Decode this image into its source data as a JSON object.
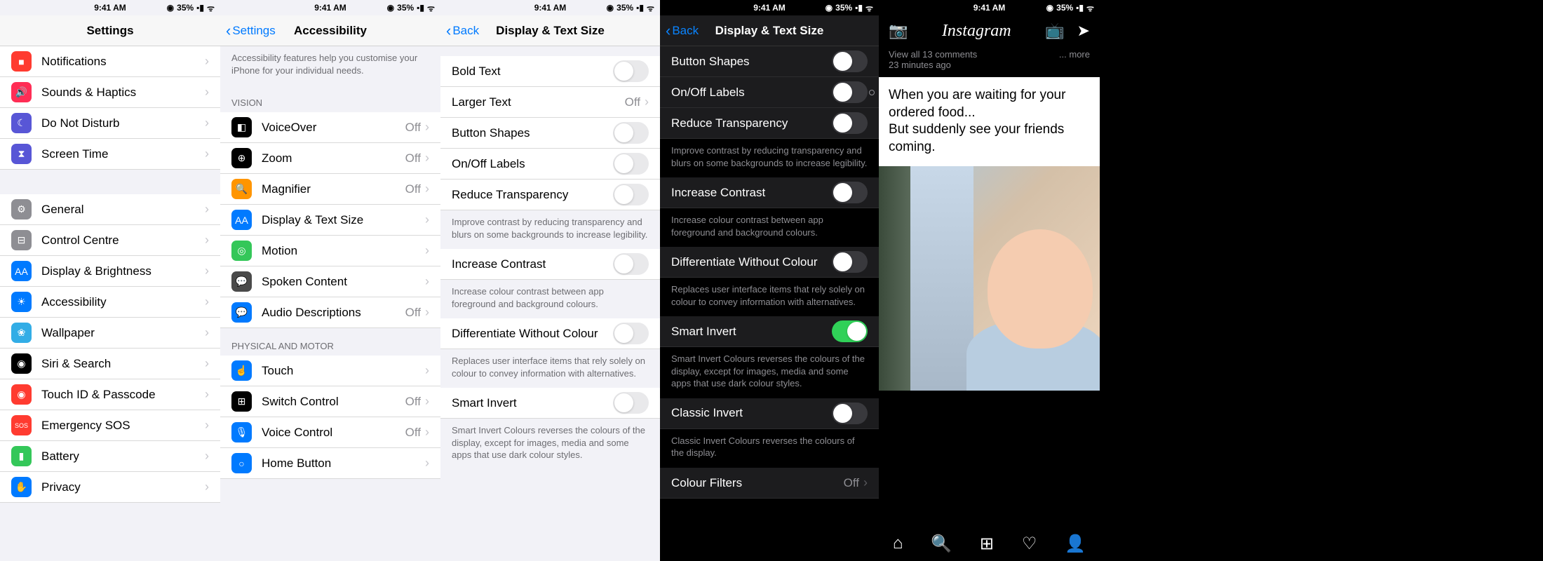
{
  "status": {
    "time": "9:41 AM",
    "battery": "35%",
    "wifi": "●"
  },
  "p1": {
    "title": "Settings",
    "group1": [
      {
        "icon_bg": "ic-red",
        "glyph": "■",
        "label": "Notifications"
      },
      {
        "icon_bg": "ic-pink",
        "glyph": "🔊",
        "label": "Sounds & Haptics"
      },
      {
        "icon_bg": "ic-purple",
        "glyph": "☾",
        "label": "Do Not Disturb"
      },
      {
        "icon_bg": "ic-indigo",
        "glyph": "⧗",
        "label": "Screen Time"
      }
    ],
    "group2": [
      {
        "icon_bg": "ic-gray",
        "glyph": "⚙",
        "label": "General"
      },
      {
        "icon_bg": "ic-gray",
        "glyph": "⊟",
        "label": "Control Centre"
      },
      {
        "icon_bg": "ic-blue",
        "glyph": "AA",
        "label": "Display & Brightness"
      },
      {
        "icon_bg": "ic-blue",
        "glyph": "☀",
        "label": "Accessibility"
      },
      {
        "icon_bg": "ic-cyan",
        "glyph": "❀",
        "label": "Wallpaper"
      },
      {
        "icon_bg": "ic-black",
        "glyph": "◉",
        "label": "Siri & Search"
      },
      {
        "icon_bg": "ic-red",
        "glyph": "◉",
        "label": "Touch ID & Passcode"
      },
      {
        "icon_bg": "ic-red",
        "glyph": "SOS",
        "label": "Emergency SOS"
      },
      {
        "icon_bg": "ic-green",
        "glyph": "▮",
        "label": "Battery"
      },
      {
        "icon_bg": "ic-blue",
        "glyph": "✋",
        "label": "Privacy"
      }
    ]
  },
  "p2": {
    "back": "Settings",
    "title": "Accessibility",
    "intro": "Accessibility features help you customise your iPhone for your individual needs.",
    "hdr_vision": "VISION",
    "vision": [
      {
        "icon_bg": "ic-black",
        "glyph": "◧",
        "label": "VoiceOver",
        "value": "Off"
      },
      {
        "icon_bg": "ic-black",
        "glyph": "⊕",
        "label": "Zoom",
        "value": "Off"
      },
      {
        "icon_bg": "ic-orange",
        "glyph": "🔍",
        "label": "Magnifier",
        "value": "Off"
      },
      {
        "icon_bg": "ic-blue",
        "glyph": "AA",
        "label": "Display & Text Size",
        "value": ""
      },
      {
        "icon_bg": "ic-green",
        "glyph": "◎",
        "label": "Motion",
        "value": ""
      },
      {
        "icon_bg": "ic-darkgray",
        "glyph": "💬",
        "label": "Spoken Content",
        "value": ""
      },
      {
        "icon_bg": "ic-blue",
        "glyph": "💬",
        "label": "Audio Descriptions",
        "value": "Off"
      }
    ],
    "hdr_motor": "PHYSICAL AND MOTOR",
    "motor": [
      {
        "icon_bg": "ic-blue",
        "glyph": "☝",
        "label": "Touch",
        "value": ""
      },
      {
        "icon_bg": "ic-black",
        "glyph": "⊞",
        "label": "Switch Control",
        "value": "Off"
      },
      {
        "icon_bg": "ic-blue",
        "glyph": "🎙",
        "label": "Voice Control",
        "value": "Off"
      },
      {
        "icon_bg": "ic-blue",
        "glyph": "○",
        "label": "Home Button",
        "value": ""
      }
    ]
  },
  "p3": {
    "back": "Back",
    "title": "Display & Text Size",
    "rows": {
      "bold": "Bold Text",
      "larger": "Larger Text",
      "larger_val": "Off",
      "shapes": "Button Shapes",
      "onoff": "On/Off Labels",
      "reduce_t": "Reduce Transparency",
      "reduce_t_desc": "Improve contrast by reducing transparency and blurs on some backgrounds to increase legibility.",
      "inc_c": "Increase Contrast",
      "inc_c_desc": "Increase colour contrast between app foreground and background colours.",
      "diff": "Differentiate Without Colour",
      "diff_desc": "Replaces user interface items that rely solely on colour to convey information with alternatives.",
      "smart": "Smart Invert",
      "smart_desc": "Smart Invert Colours reverses the colours of the display, except for images, media and some apps that use dark colour styles."
    }
  },
  "p4": {
    "back": "Back",
    "title": "Display & Text Size",
    "rows": {
      "shapes": "Button Shapes",
      "onoff": "On/Off Labels",
      "reduce_t": "Reduce Transparency",
      "reduce_t_desc": "Improve contrast by reducing transparency and blurs on some backgrounds to increase legibility.",
      "inc_c": "Increase Contrast",
      "inc_c_desc": "Increase colour contrast between app foreground and background colours.",
      "diff": "Differentiate Without Colour",
      "diff_desc": "Replaces user interface items that rely solely on colour to convey information with alternatives.",
      "smart": "Smart Invert",
      "smart_desc": "Smart Invert Colours reverses the colours of the display, except for images, media and some apps that use dark colour styles.",
      "classic": "Classic Invert",
      "classic_desc": "Classic Invert Colours reverses the colours of the display.",
      "filters": "Colour Filters",
      "filters_val": "Off"
    }
  },
  "p5": {
    "logo": "Instagram",
    "meta_comments": "View all 13 comments",
    "meta_time": "23 minutes ago",
    "meta_more": "... more",
    "caption": "When you are waiting for your ordered food...\nBut suddenly see your friends coming."
  }
}
